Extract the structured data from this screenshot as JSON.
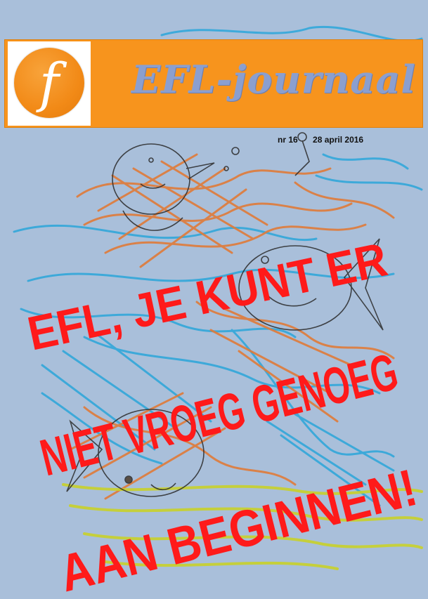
{
  "header": {
    "logo_letter": "f",
    "title": "EFL-journaal",
    "accent_color": "#f7941d"
  },
  "issue": {
    "number": "nr 16",
    "date": "28 april 2016"
  },
  "headline": {
    "line1": "EFL, JE KUNT ER",
    "line2": "NIET VROEG GENOEG",
    "line3": "AAN BEGINNEN!",
    "color": "#ff1a1a"
  },
  "cover_art": {
    "icon": "crayon-fish-drawing",
    "colors": [
      "#e07b39",
      "#2ba6d9",
      "#c9d12a",
      "#2b2b2b"
    ]
  }
}
